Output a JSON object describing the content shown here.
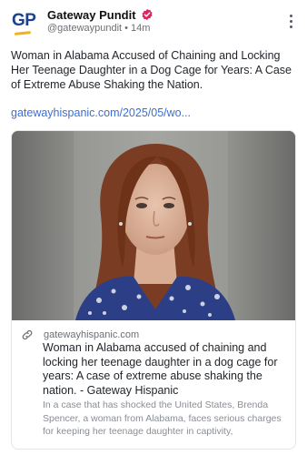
{
  "account": {
    "avatar_text": "GP",
    "display_name": "Gateway Pundit",
    "handle": "@gatewaypundit",
    "separator": "•",
    "time_ago": "14m",
    "verified_color": "#e0245e"
  },
  "post": {
    "text": "Woman in Alabama Accused of Chaining and Locking Her Teenage Daughter in a Dog Cage for Years: A Case of Extreme Abuse Shaking the Nation.",
    "link_text": "gatewayhispanic.com/2025/05/wo..."
  },
  "card": {
    "image_icon": "portrait-photo",
    "domain": "gatewayhispanic.com",
    "title": "Woman in Alabama accused of chaining and locking her teenage daughter in a dog cage for years: A case of extreme abuse shaking the nation. - Gateway Hispanic",
    "description": "In a case that has shocked the United States, Brenda Spencer, a woman from Alabama, faces serious charges for keeping her teenage daughter in captivity,"
  },
  "colors": {
    "link": "#3b6fd4",
    "brand_blue": "#1c3f8f",
    "brand_gold": "#f2b21a"
  }
}
